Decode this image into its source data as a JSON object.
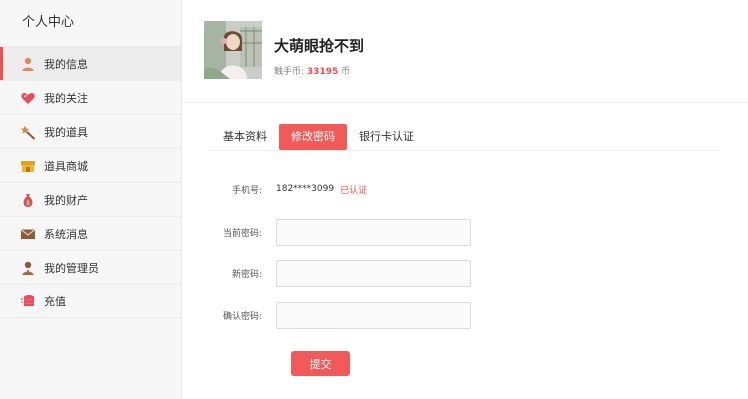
{
  "sidebar": {
    "title": "个人中心",
    "items": [
      {
        "label": "我的信息",
        "icon": "user-icon",
        "active": true
      },
      {
        "label": "我的关注",
        "icon": "heart-icon",
        "active": false
      },
      {
        "label": "我的道具",
        "icon": "magic-wand-icon",
        "active": false
      },
      {
        "label": "道具商城",
        "icon": "shop-icon",
        "active": false
      },
      {
        "label": "我的财产",
        "icon": "money-bag-icon",
        "active": false
      },
      {
        "label": "系统消息",
        "icon": "mail-icon",
        "active": false
      },
      {
        "label": "我的管理员",
        "icon": "admin-icon",
        "active": false
      },
      {
        "label": "充值",
        "icon": "coin-stack-icon",
        "active": false
      }
    ]
  },
  "profile": {
    "username": "大萌眼抢不到",
    "coins_label": "触手币:",
    "coins_value": "33195",
    "coins_unit": "币"
  },
  "tabs": [
    {
      "label": "基本资料",
      "active": false
    },
    {
      "label": "修改密码",
      "active": true
    },
    {
      "label": "银行卡认证",
      "active": false
    }
  ],
  "form": {
    "phone_label": "手机号:",
    "phone_value": "182****3099",
    "phone_status": "已认证",
    "current_password_label": "当前密码:",
    "current_password_value": "",
    "new_password_label": "新密码:",
    "new_password_value": "",
    "confirm_password_label": "确认密码:",
    "confirm_password_value": "",
    "submit_label": "提交"
  },
  "colors": {
    "accent": "#f25a5a",
    "sidebar_bg": "#f7f7f7"
  }
}
